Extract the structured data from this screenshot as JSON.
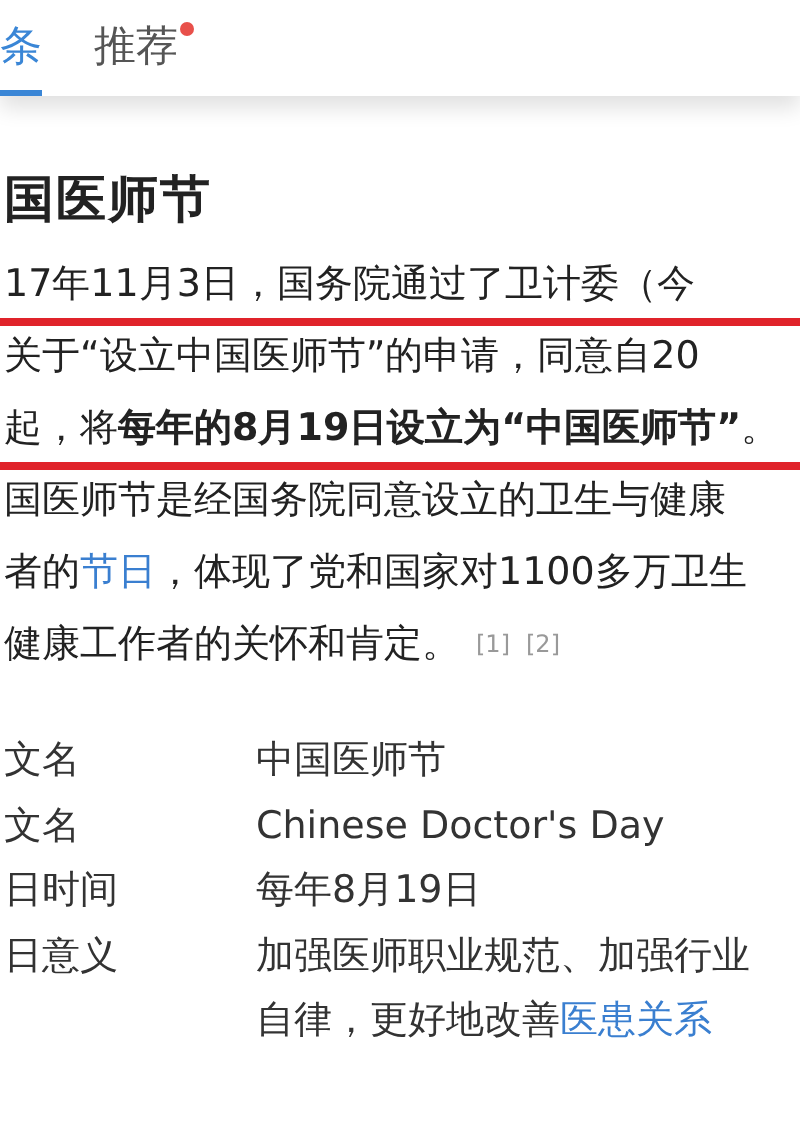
{
  "tabs": [
    {
      "label": "条",
      "selected": true,
      "dot": false
    },
    {
      "label": "推荐",
      "selected": false,
      "dot": true
    }
  ],
  "article": {
    "title": "国医师节",
    "lines": [
      {
        "underlined": true,
        "segments": [
          {
            "kind": "text",
            "text": "17年11月3日，国务院通过了卫计委（今"
          }
        ]
      },
      {
        "underlined": false,
        "segments": [
          {
            "kind": "text",
            "text": "关于“设立中国医师节”的申请，同意自20"
          }
        ]
      },
      {
        "underlined": true,
        "segments": [
          {
            "kind": "text",
            "text": "起，将**每年的8月19日设立为“中国医师节”**。"
          }
        ]
      },
      {
        "underlined": false,
        "segments": [
          {
            "kind": "text",
            "text": "国医师节是经国务院同意设立的卫生与健康"
          }
        ]
      },
      {
        "underlined": false,
        "segments": [
          {
            "kind": "text",
            "text": "者的"
          },
          {
            "kind": "link",
            "text": "节日"
          },
          {
            "kind": "text",
            "text": "，体现了党和国家对1100多万卫生"
          }
        ]
      },
      {
        "underlined": false,
        "segments": [
          {
            "kind": "text",
            "text": "健康工作者的关怀和肯定。"
          },
          {
            "kind": "ref",
            "text": "[1]"
          },
          {
            "kind": "ref",
            "text": "[2]"
          }
        ]
      }
    ],
    "info": [
      {
        "label": "文名",
        "value": [
          {
            "kind": "text",
            "text": "中国医师节"
          }
        ]
      },
      {
        "label": "文名",
        "value": [
          {
            "kind": "text",
            "text": "Chinese Doctor's Day"
          }
        ]
      },
      {
        "label": "日时间",
        "value": [
          {
            "kind": "text",
            "text": "每年8月19日"
          }
        ]
      },
      {
        "label": "日意义",
        "value": [
          {
            "kind": "text",
            "text": "加强医师职业规范、加强行业自律，更好地改善"
          },
          {
            "kind": "link",
            "text": "医患关系"
          }
        ]
      }
    ]
  }
}
